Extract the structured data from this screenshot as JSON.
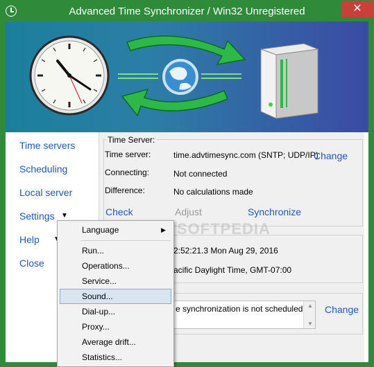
{
  "window": {
    "title": "Advanced Time Synchronizer / Win32 Unregistered",
    "close_glyph": "✕"
  },
  "sidebar": {
    "items": [
      {
        "label": "Time servers"
      },
      {
        "label": "Scheduling"
      },
      {
        "label": "Local server"
      },
      {
        "label": "Settings"
      },
      {
        "label": "Help"
      },
      {
        "label": "Close"
      }
    ]
  },
  "time_server": {
    "group_title": "Time Server:",
    "server_label": "Time server:",
    "server_value": "time.advtimesync.com (SNTP; UDP/IP)",
    "change_label": "Change",
    "connecting_label": "Connecting:",
    "connecting_value": "Not connected",
    "difference_label": "Difference:",
    "difference_value": "No calculations made",
    "check_label": "Check",
    "adjust_label": "Adjust",
    "synchronize_label": "Synchronize"
  },
  "local_time": {
    "time_value": "2:52:21.3 Mon Aug 29, 2016",
    "zone_value": "acific Daylight Time, GMT-07:00"
  },
  "schedule": {
    "status_text": "e synchronization is not scheduled",
    "change_label": "Change"
  },
  "context_menu": {
    "items": [
      {
        "label": "Language",
        "submenu": true
      },
      {
        "label": "Run..."
      },
      {
        "label": "Operations..."
      },
      {
        "label": "Service..."
      },
      {
        "label": "Sound..."
      },
      {
        "label": "Dial-up..."
      },
      {
        "label": "Proxy..."
      },
      {
        "label": "Average drift..."
      },
      {
        "label": "Statistics..."
      }
    ],
    "highlighted": "Sound..."
  },
  "watermark": "SOFTPEDIA",
  "colors": {
    "titlebar": "#2f8b3a",
    "close_button": "#c7413a",
    "link": "#1f58b8",
    "menu_highlight": "#d8e6f2"
  }
}
